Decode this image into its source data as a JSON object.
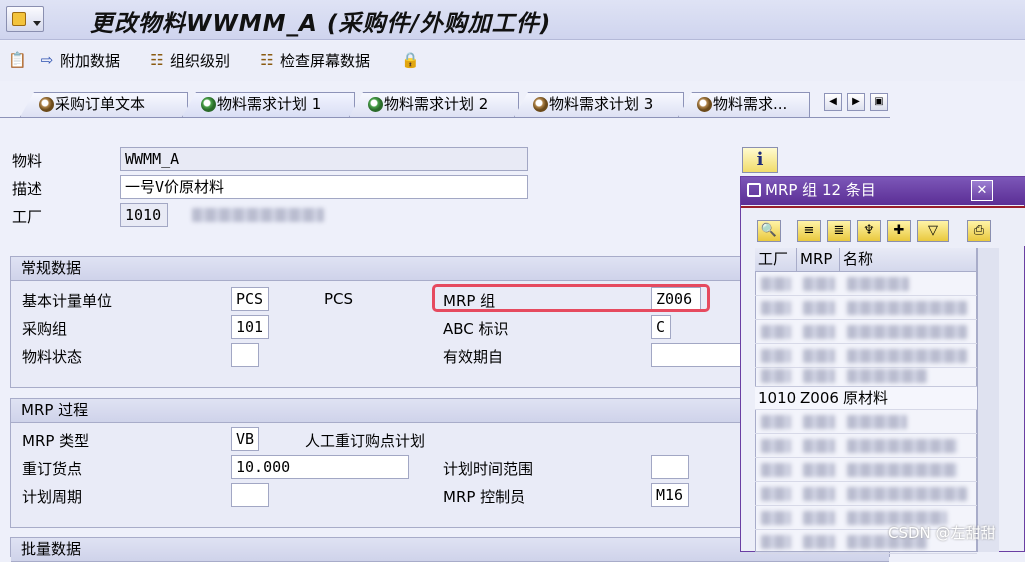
{
  "title_bar": {
    "title": "更改物料WWMM_A (采购件/外购加工件)"
  },
  "toolbar": {
    "items": [
      {
        "label": "",
        "icon": "copy-icon"
      },
      {
        "label": "附加数据",
        "icon": "arrow-right-icon"
      },
      {
        "label": "组织级别",
        "icon": "org-tree-icon"
      },
      {
        "label": "检查屏幕数据",
        "icon": "check-screen-icon"
      },
      {
        "label": "",
        "icon": "lock-icon"
      }
    ]
  },
  "tabs": [
    {
      "label": "采购订单文本",
      "active": false
    },
    {
      "label": "物料需求计划 1",
      "active": true
    },
    {
      "label": "物料需求计划 2",
      "active": false
    },
    {
      "label": "物料需求计划 3",
      "active": false
    },
    {
      "label": "物料需求...",
      "active": false
    }
  ],
  "header": {
    "material_label": "物料",
    "material_value": "WWMM_A",
    "description_label": "描述",
    "description_value": "一号V价原材料",
    "plant_label": "工厂",
    "plant_value": "1010"
  },
  "general": {
    "title": "常规数据",
    "base_uom_label": "基本计量单位",
    "base_uom_value": "PCS",
    "base_uom_text": "PCS",
    "mrp_group_label": "MRP 组",
    "mrp_group_value": "Z006",
    "purch_group_label": "采购组",
    "purch_group_value": "101",
    "abc_label": "ABC 标识",
    "abc_value": "C",
    "material_status_label": "物料状态",
    "material_status_value": "",
    "valid_from_label": "有效期自",
    "valid_from_value": ""
  },
  "mrp_procedure": {
    "title": "MRP 过程",
    "mrp_type_label": "MRP 类型",
    "mrp_type_value": "VB",
    "mrp_type_text": "人工重订购点计划",
    "reorder_label": "重订货点",
    "reorder_value": "10.000",
    "planning_fence_label": "计划时间范围",
    "planning_fence_value": "",
    "planning_cycle_label": "计划周期",
    "planning_cycle_value": "",
    "mrp_controller_label": "MRP 控制员",
    "mrp_controller_value": "M16"
  },
  "lot_size": {
    "title": "批量数据"
  },
  "popup": {
    "title": "MRP 组 12 条目",
    "columns": [
      "工厂",
      "MRP",
      "名称"
    ],
    "visible_row": {
      "plant": "1010",
      "mrp": "Z006",
      "name": "原材料"
    }
  },
  "watermark": "CSDN @左甜甜",
  "colors": {
    "highlight": "#e64a5f",
    "popup_title": "#5b2e95"
  }
}
